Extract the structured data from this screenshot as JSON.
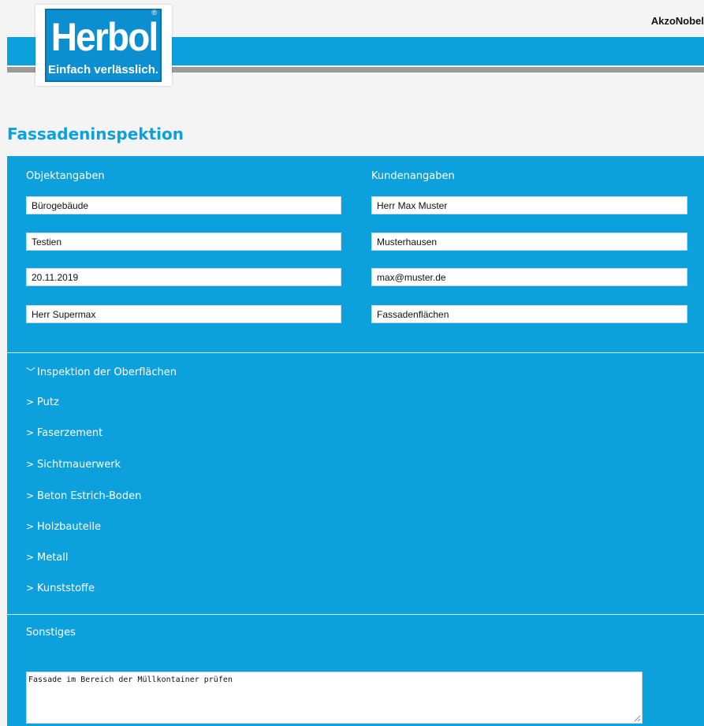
{
  "header": {
    "brand_right": "AkzoNobel",
    "logo": {
      "word": "Herbol",
      "slogan": "Einfach verlässlich.",
      "registered": "®"
    }
  },
  "page_title": "Fassadeninspektion",
  "objektangaben": {
    "heading": "Objektangaben",
    "fields": [
      "Bürogebäude",
      "Testien",
      "20.11.2019",
      "Herr Supermax"
    ]
  },
  "kundenangaben": {
    "heading": "Kundenangaben",
    "fields": [
      "Herr Max Muster",
      "Musterhausen",
      "max@muster.de",
      "Fassadenflächen"
    ]
  },
  "accordion": [
    {
      "label": "Inspektion der Oberflächen",
      "expanded": true,
      "icon": "chevron-down-icon",
      "glyph": "﹀"
    },
    {
      "label": "Putz",
      "expanded": false,
      "icon": "chevron-right-icon",
      "glyph": ">"
    },
    {
      "label": "Faserzement",
      "expanded": false,
      "icon": "chevron-right-icon",
      "glyph": ">"
    },
    {
      "label": "Sichtmauerwerk",
      "expanded": false,
      "icon": "chevron-right-icon",
      "glyph": ">"
    },
    {
      "label": "Beton Estrich-Boden",
      "expanded": false,
      "icon": "chevron-right-icon",
      "glyph": ">"
    },
    {
      "label": "Holzbauteile",
      "expanded": false,
      "icon": "chevron-right-icon",
      "glyph": ">"
    },
    {
      "label": "Metall",
      "expanded": false,
      "icon": "chevron-right-icon",
      "glyph": ">"
    },
    {
      "label": "Kunststoffe",
      "expanded": false,
      "icon": "chevron-right-icon",
      "glyph": ">"
    }
  ],
  "sonstiges": {
    "heading": "Sonstiges",
    "text": "Fassade im Bereich der Müllkontainer prüfen"
  },
  "colors": {
    "accent": "#0ca0dc",
    "gray_bar": "#9a9a9a",
    "background": "#f4f4f4"
  }
}
